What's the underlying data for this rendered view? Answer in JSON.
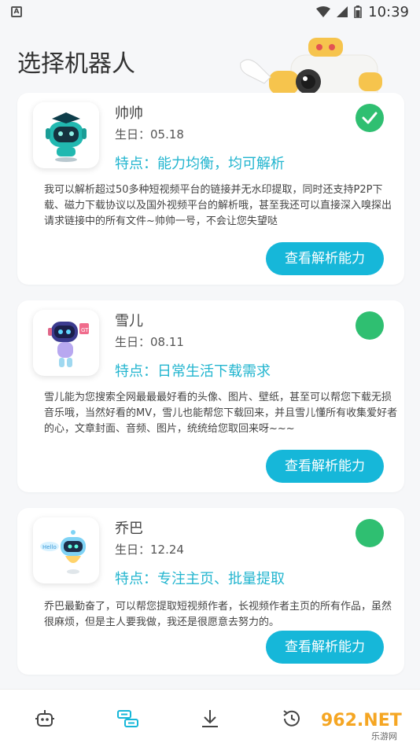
{
  "status_bar": {
    "left_icon": "A",
    "time": "10:39",
    "icons": [
      "wifi-icon",
      "signal-icon",
      "battery-icon"
    ]
  },
  "page": {
    "title": "选择机器人"
  },
  "bots": [
    {
      "name": "帅帅",
      "birthday": "生日：05.18",
      "feature": "特点：能力均衡，均可解析",
      "description": "我可以解析超过50多种短视频平台的链接并无水印提取，同时还支持P2P下载、磁力下载协议以及国外视频平台的解析哦，甚至我还可以直接深入嗅探出请求链接中的所有文件~帅帅一号，不会让您失望哒",
      "selected": true,
      "button": "查看解析能力"
    },
    {
      "name": "雪儿",
      "birthday": "生日：08.11",
      "feature": "特点：日常生活下载需求",
      "description": "雪儿能为您搜索全网最最最好看的头像、图片、壁纸，甚至可以帮您下载无损音乐哦，当然好看的MV，雪儿也能帮您下载回来，并且雪儿懂所有收集爱好者的心，文章封面、音频、图片，统统给您取回来呀~~~",
      "selected": false,
      "button": "查看解析能力"
    },
    {
      "name": "乔巴",
      "birthday": "生日：12.24",
      "feature": "特点：专注主页、批量提取",
      "description": "乔巴最勤奋了，可以帮您提取短视频作者，长视频作者主页的所有作品，虽然很麻烦，但是主人要我做，我还是很愿意去努力的。",
      "selected": false,
      "button": "查看解析能力"
    }
  ],
  "bottom_nav": [
    "robot-icon",
    "parse-icon",
    "download-icon",
    "history-icon"
  ],
  "watermark": {
    "text": "962.NET",
    "sub": "乐游网"
  },
  "colors": {
    "accent": "#16b7d9",
    "feature": "#22b5cf",
    "selected": "#2fbf71"
  }
}
